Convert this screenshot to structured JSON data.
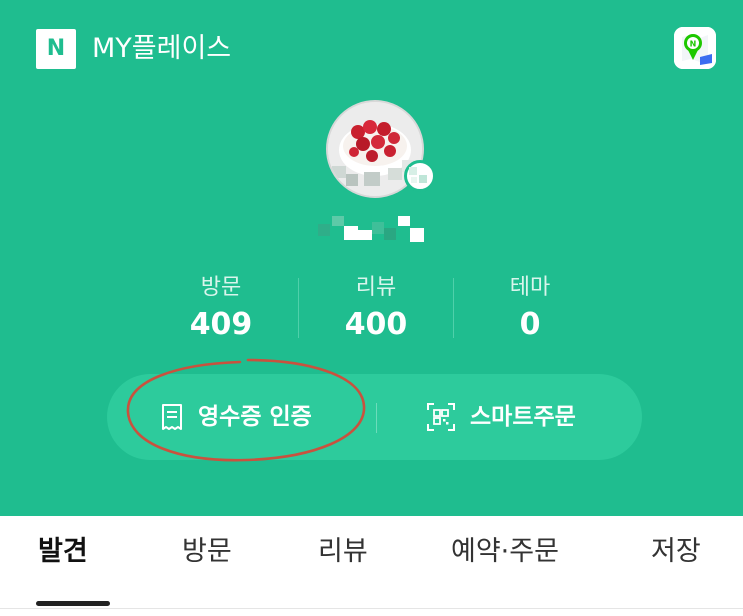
{
  "header": {
    "logo_letter": "N",
    "title": "MY플레이스",
    "background_color": "#1fbd8f",
    "map_button_icon": "naver-map-icon"
  },
  "profile": {
    "avatar_icon": "profile-photo-strawberry-cake",
    "badge_icon": "profile-badge-icon",
    "nickname_obscured": true
  },
  "stats": [
    {
      "label": "방문",
      "value": "409"
    },
    {
      "label": "리뷰",
      "value": "400"
    },
    {
      "label": "테마",
      "value": "0"
    }
  ],
  "actions": {
    "receipt": {
      "label": "영수증 인증",
      "icon": "receipt-icon"
    },
    "smart_order": {
      "label": "스마트주문",
      "icon": "qr-code-icon"
    }
  },
  "annotation": {
    "color": "#c9523e",
    "target": "receipt"
  },
  "tabs": [
    {
      "label": "발견",
      "active": true
    },
    {
      "label": "방문",
      "active": false
    },
    {
      "label": "리뷰",
      "active": false
    },
    {
      "label": "예약·주문",
      "active": false
    },
    {
      "label": "저장",
      "active": false
    }
  ]
}
